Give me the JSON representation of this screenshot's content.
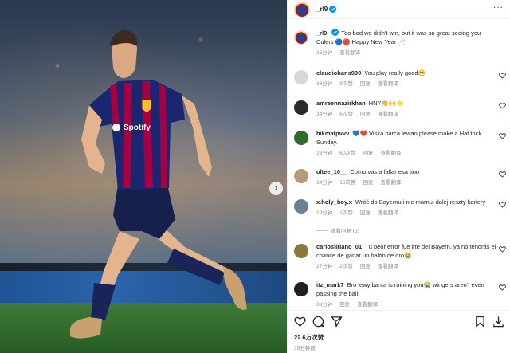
{
  "post": {
    "username": "_rl9",
    "more_icon": "ellipsis-icon",
    "verified_icon": "verified-badge-icon",
    "colors": {
      "accent": "#0095f6",
      "muted": "#8e8e8e",
      "text": "#262626",
      "heart": "#ed4956"
    }
  },
  "caption": {
    "username": "_rl9",
    "text": "Too bad we didn't win, but it was so great seeing you Culers 🔵🔴 Happy New Year 🥂",
    "time": "35分钟",
    "translate": "查看翻译"
  },
  "comments": [
    {
      "username": "claudiohans999",
      "text": "You play really good😁",
      "time": "33分钟",
      "likes": "9次赞",
      "reply": "回复",
      "translate": "查看翻译"
    },
    {
      "username": "amreennazirkhan",
      "text": "HNY👏🙌🌟",
      "time": "34分钟",
      "likes": "6次赞",
      "reply": "回复",
      "translate": "查看翻译"
    },
    {
      "username": "hikmatpvvv",
      "text": "💙❤️ Visca barca lewan please make a Hat trick Sunday.",
      "time": "28分钟",
      "likes": "60次赞",
      "reply": "回复",
      "translate": "查看翻译"
    },
    {
      "username": "oltee_10__",
      "text": "Como vas a fallar esa tioo",
      "time": "34分钟",
      "likes": "16次赞",
      "reply": "回复",
      "translate": "查看翻译"
    },
    {
      "username": "x.holy_boy.x",
      "text": "Wróć do Bayernu i nie marnuj dalej reszty kariery",
      "time": "29分钟",
      "likes": "1次赞",
      "reply": "回复",
      "translate": "查看翻译",
      "view_replies": "查看回复 (5)"
    },
    {
      "username": "carlosliriano_01",
      "text": "Tú peor error fue irte del Bayern, ya no tendrás el chance de ganar un balón de oro😭",
      "time": "27分钟",
      "likes": "2次赞",
      "reply": "回复",
      "translate": "查看翻译"
    },
    {
      "username": "itz_mark7",
      "text": "Bro lewy barca is ruining you😭 wingers aren't even passing the ball!",
      "time": "33分钟",
      "likes": "",
      "reply": "回复",
      "translate": "查看翻译"
    }
  ],
  "footer": {
    "likes": "22.6万次赞",
    "time_ago": "35分钟前",
    "icons": [
      "heart-icon",
      "comment-icon",
      "share-icon",
      "bookmark-icon",
      "download-icon"
    ]
  },
  "photo": {
    "sponsor": "Spotify",
    "next_arrow": "›"
  }
}
